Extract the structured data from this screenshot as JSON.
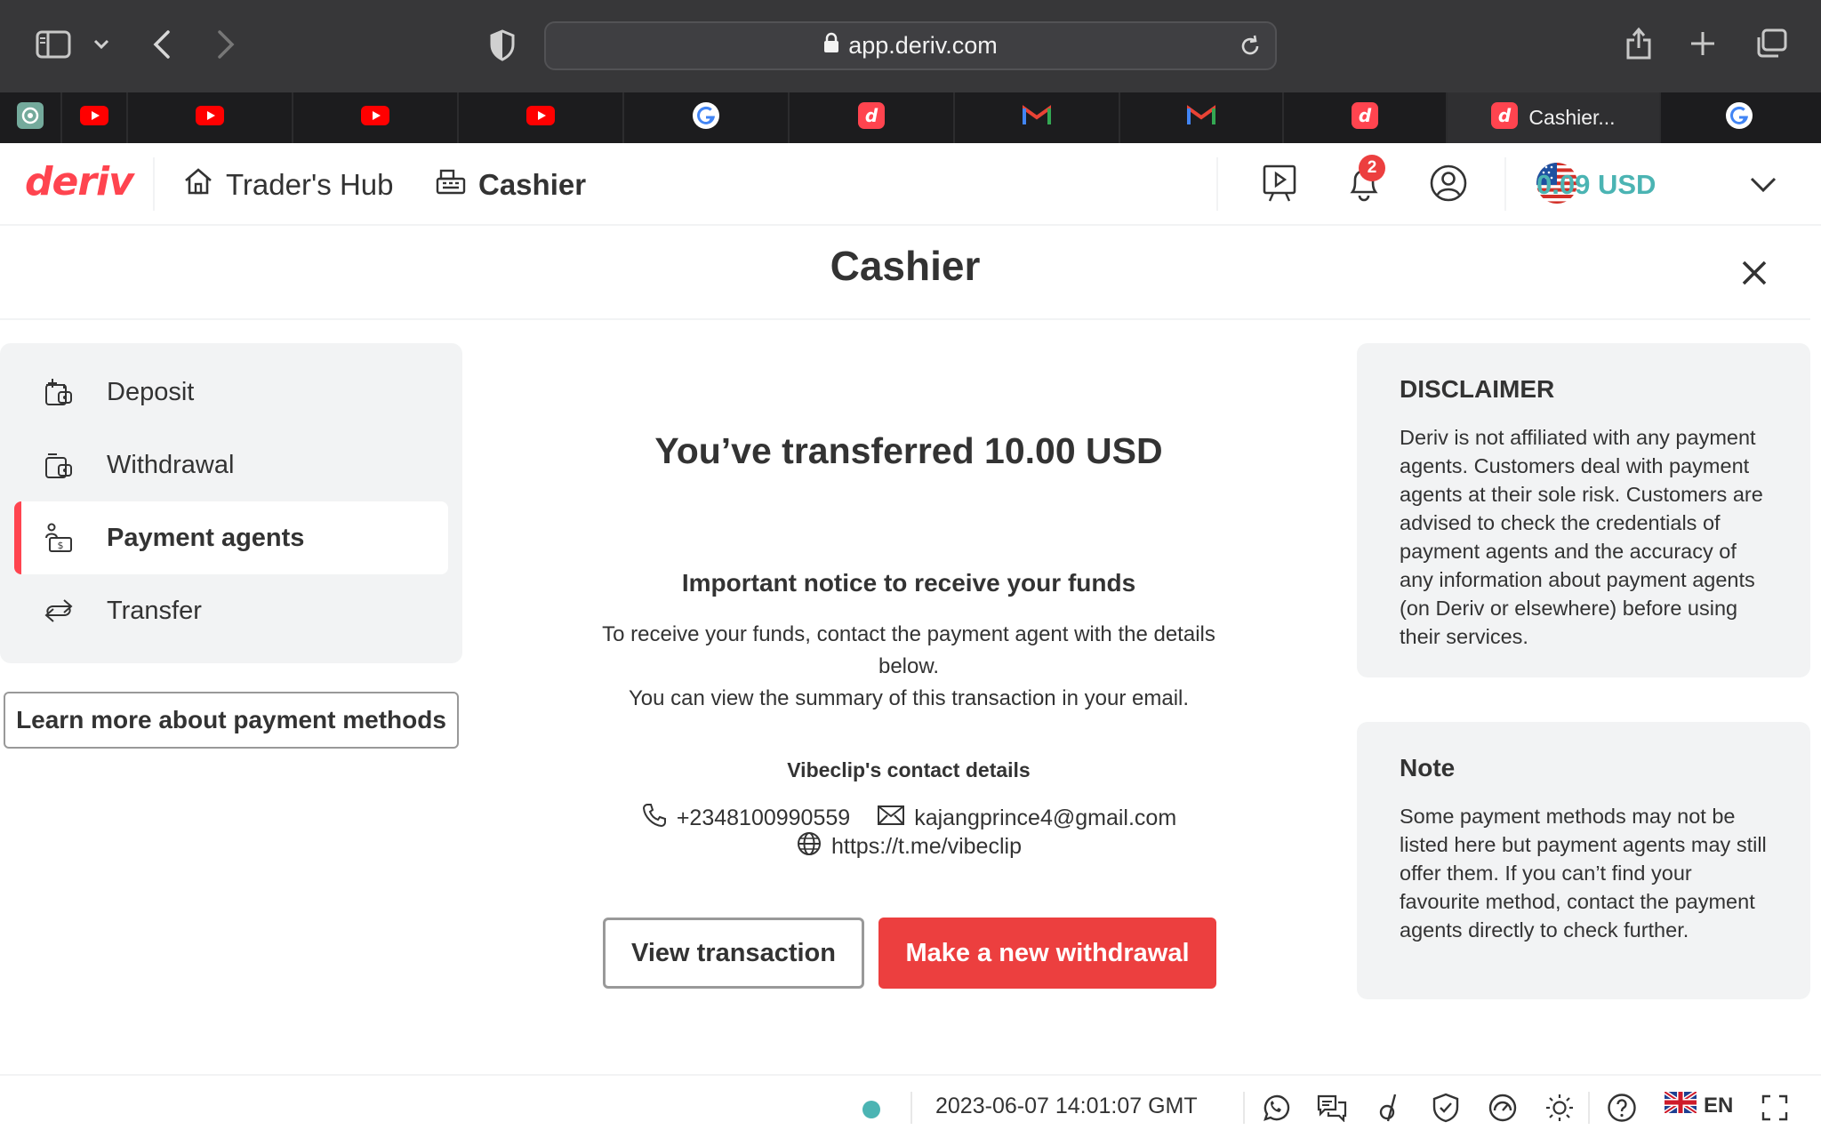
{
  "browser": {
    "url": "app.deriv.com",
    "active_tab_title": "Cashier...",
    "tabs": [
      "chatgpt",
      "youtube",
      "youtube",
      "youtube",
      "youtube",
      "google",
      "deriv",
      "gmail",
      "gmail",
      "deriv",
      "deriv-active",
      "google"
    ]
  },
  "header": {
    "logo": "deriv",
    "traders_hub": "Trader's Hub",
    "cashier": "Cashier",
    "notification_count": "2",
    "balance": "0.09 USD"
  },
  "page": {
    "title": "Cashier"
  },
  "sidebar": {
    "items": [
      {
        "label": "Deposit",
        "icon": "deposit-icon"
      },
      {
        "label": "Withdrawal",
        "icon": "withdrawal-icon"
      },
      {
        "label": "Payment agents",
        "icon": "payment-agents-icon",
        "active": true
      },
      {
        "label": "Transfer",
        "icon": "transfer-icon"
      }
    ],
    "learn_more": "Learn more about payment methods"
  },
  "main": {
    "headline": "You’ve transferred 10.00 USD",
    "notice_title": "Important notice to receive your funds",
    "notice_line1": "To receive your funds, contact the payment agent with the details",
    "notice_line2": "below.",
    "notice_line3": "You can view the summary of this transaction in your email.",
    "contact_title": "Vibeclip's contact details",
    "phone": "+2348100990559",
    "email": "kajangprince4@gmail.com",
    "website": "https://t.me/vibeclip",
    "view_transaction": "View transaction",
    "new_withdrawal": "Make a new withdrawal"
  },
  "disclaimer": {
    "title": "DISCLAIMER",
    "text": "Deriv is not affiliated with any payment agents. Customers deal with payment agents at their sole risk. Customers are advised to check the credentials of payment agents and the accuracy of any information about payment agents (on Deriv or elsewhere) before using their services."
  },
  "note": {
    "title": "Note",
    "text": "Some payment methods may not be listed here but payment agents may still offer them. If you can’t find your favourite method, contact the payment agents directly to check further."
  },
  "footer": {
    "datetime": "2023-06-07 14:01:07 GMT",
    "language": "EN"
  },
  "colors": {
    "brand_red": "#ff444f",
    "button_red": "#ec3f3f",
    "balance_teal": "#4bb4b3",
    "panel_gray": "#f2f3f4"
  }
}
